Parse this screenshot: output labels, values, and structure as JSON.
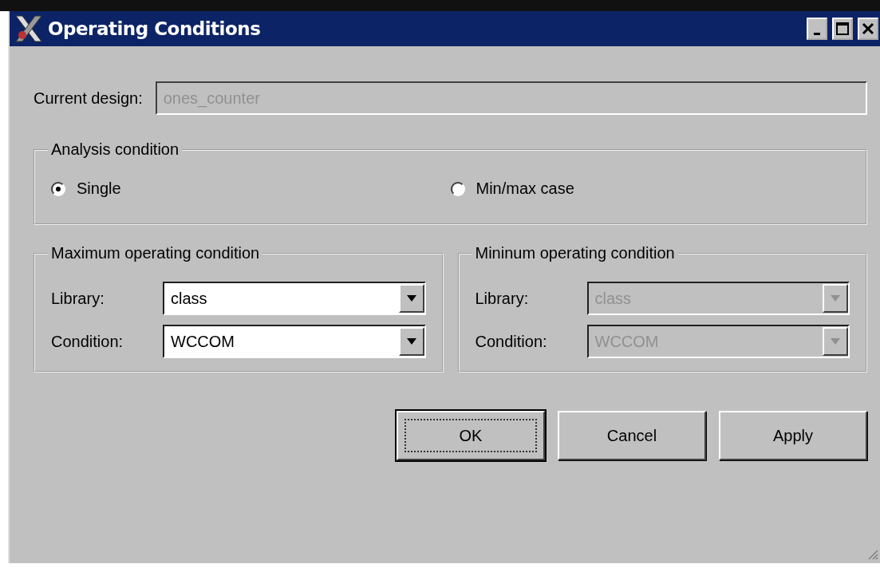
{
  "window": {
    "title": "Operating Conditions"
  },
  "current_design": {
    "label": "Current design:",
    "value": "ones_counter",
    "disabled": true
  },
  "analysis_condition": {
    "title": "Analysis condition",
    "options": [
      {
        "label": "Single",
        "selected": true
      },
      {
        "label": "Min/max case",
        "selected": false
      }
    ]
  },
  "groups": [
    {
      "title": "Maximum operating condition",
      "fields": [
        {
          "label": "Library:",
          "value": "class",
          "disabled": false
        },
        {
          "label": "Condition:",
          "value": "WCCOM",
          "disabled": false
        }
      ]
    },
    {
      "title": "Mininum operating condition",
      "fields": [
        {
          "label": "Library:",
          "value": "class",
          "disabled": true
        },
        {
          "label": "Condition:",
          "value": "WCCOM",
          "disabled": true
        }
      ]
    }
  ],
  "buttons": [
    {
      "label": "OK",
      "default": true
    },
    {
      "label": "Cancel",
      "default": false
    },
    {
      "label": "Apply",
      "default": false
    }
  ]
}
